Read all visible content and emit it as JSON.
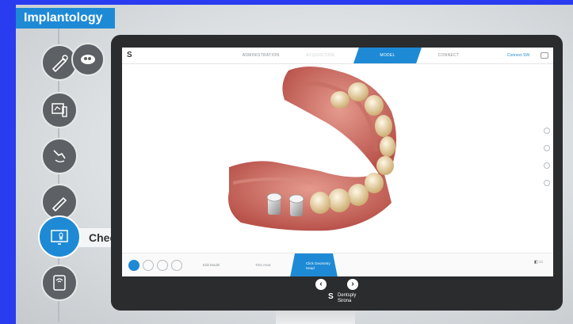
{
  "brand": {
    "title": "Implantology"
  },
  "steps": [
    {
      "name": "consultation-step",
      "icon": "scanner-wand-icon"
    },
    {
      "name": "planning-step",
      "icon": "treatment-plan-icon"
    },
    {
      "name": "drilling-step",
      "icon": "drill-icon"
    },
    {
      "name": "scanning-step",
      "icon": "scanner-wand-icon"
    },
    {
      "name": "check-step",
      "icon": "monitor-tooth-icon",
      "label": "Check",
      "active": true
    },
    {
      "name": "restoration-step",
      "icon": "milling-unit-icon"
    }
  ],
  "app": {
    "tabs": [
      {
        "label": "ADMINISTRATION",
        "active": false
      },
      {
        "label": "ACQUISITION",
        "active": false
      },
      {
        "label": "MODEL",
        "active": true
      },
      {
        "label": "CONNECT",
        "active": false
      }
    ],
    "connect_link": "Connect SW",
    "bottom": {
      "tools": [
        "scan-body-tool-1",
        "scan-body-tool-2",
        "scan-body-tool-3",
        "scan-body-tool-4"
      ],
      "items": [
        "Edit Model",
        "Trim Area"
      ],
      "active_item": "Click Geometry Head"
    }
  },
  "colors": {
    "accent": "#1e8ad6",
    "background": "#2a3cf0",
    "monitor": "#2b2c2e"
  },
  "footer": {
    "brand_line1": "Dentsply",
    "brand_line2": "Sirona"
  }
}
